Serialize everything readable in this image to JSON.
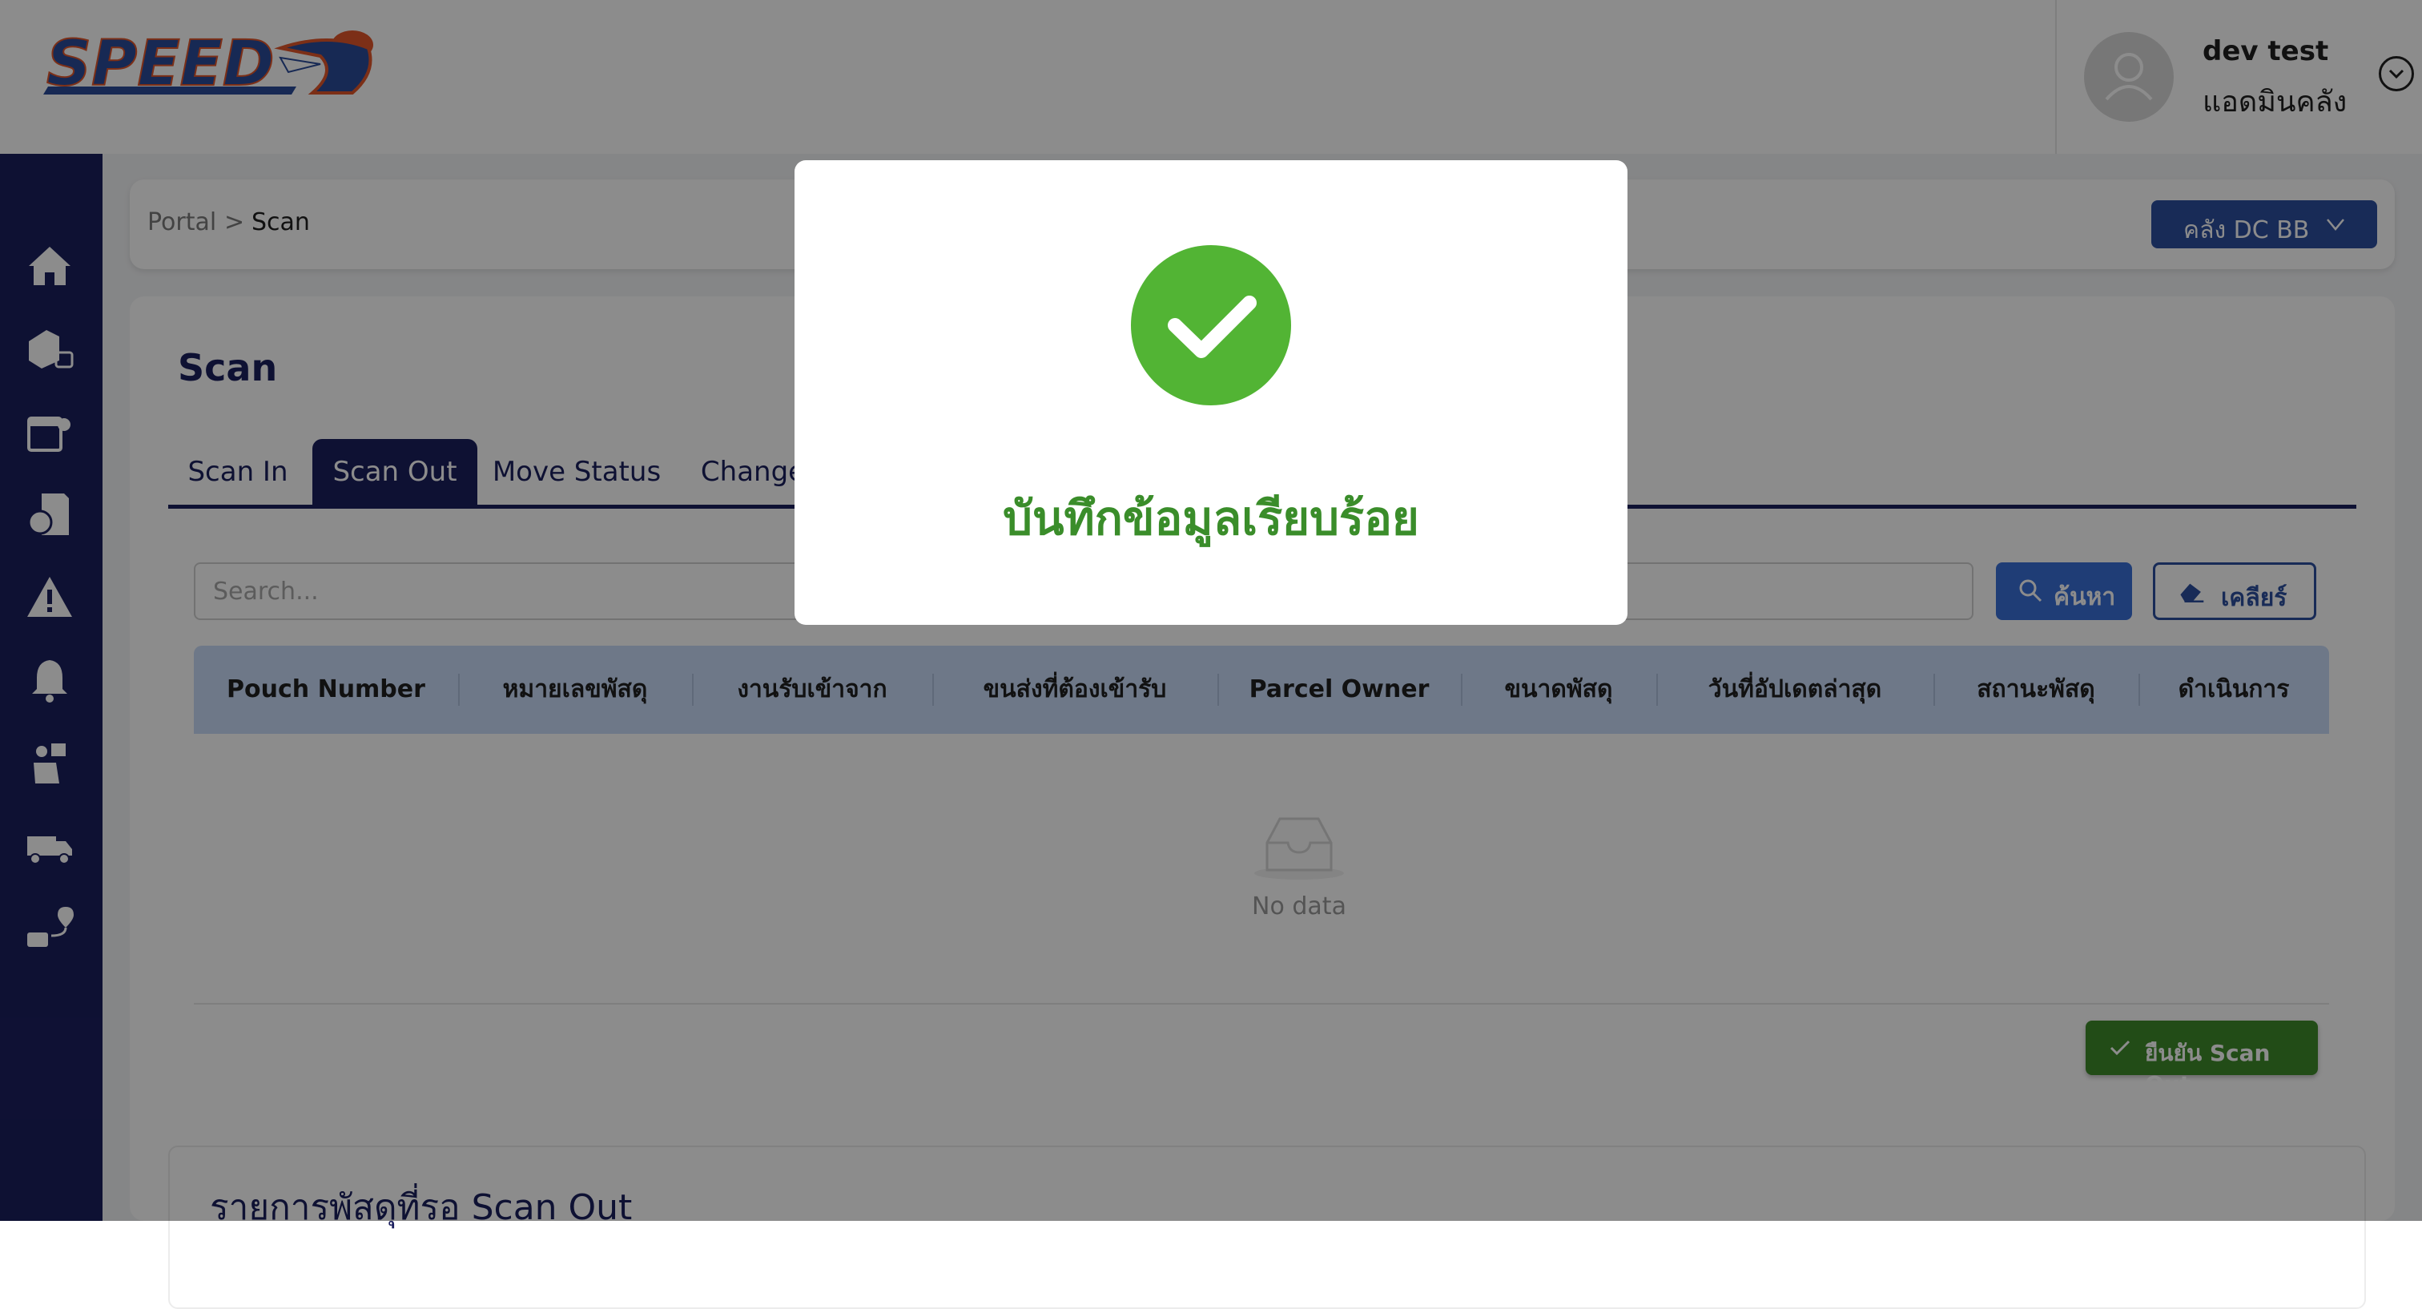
{
  "header": {
    "user_name": "dev test",
    "user_role": "แอดมินคลัง"
  },
  "breadcrumb": {
    "portal": "Portal",
    "separator": ">",
    "current": "Scan"
  },
  "warehouse_select": {
    "label": "คลัง DC BB"
  },
  "page": {
    "title": "Scan"
  },
  "tabs": [
    {
      "label": "Scan In",
      "active": false
    },
    {
      "label": "Scan Out",
      "active": true
    },
    {
      "label": "Move Status",
      "active": false
    },
    {
      "label": "Change",
      "active": false
    }
  ],
  "search": {
    "placeholder": "Search...",
    "search_button": "ค้นหา",
    "clear_button": "เคลียร์"
  },
  "table": {
    "columns": [
      "Pouch Number",
      "หมายเลขพัสดุ",
      "งานรับเข้าจาก",
      "ขนส่งที่ต้องเข้ารับ",
      "Parcel Owner",
      "ขนาดพัสดุ",
      "วันที่อัปเดตล่าสุด",
      "สถานะพัสดุ",
      "ดำเนินการ"
    ],
    "empty_text": "No data"
  },
  "confirm_button": "ยืนยัน Scan Out",
  "pending_section": {
    "title": "รายการพัสดุที่รอ Scan Out"
  },
  "modal": {
    "message": "บันทึกข้อมูลเรียบร้อย"
  },
  "colors": {
    "sidebar": "#1b1f5e",
    "primary": "#2c4f9e",
    "success": "#3a8d2a",
    "table_header": "#c8daf8"
  }
}
